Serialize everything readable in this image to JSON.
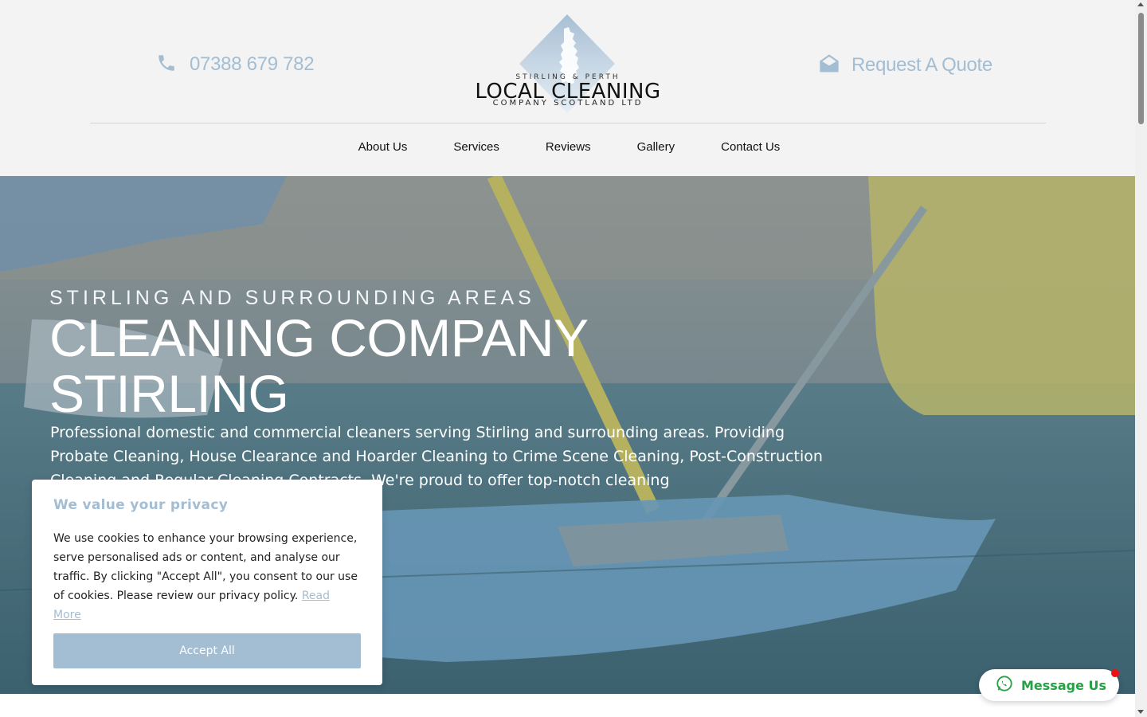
{
  "header": {
    "phone": "07388 679 782",
    "quote": "Request A Quote",
    "logo": {
      "line1": "STIRLING & PERTH",
      "line2": "LOCAL CLEANING",
      "line3": "COMPANY SCOTLAND LTD"
    }
  },
  "nav": {
    "items": [
      "About Us",
      "Services",
      "Reviews",
      "Gallery",
      "Contact Us"
    ]
  },
  "hero": {
    "eyebrow": "STIRLING AND SURROUNDING AREAS",
    "headline": "CLEANING COMPANY STIRLING",
    "description": "Professional domestic and commercial cleaners serving Stirling and surrounding areas. Providing Probate Cleaning, House Clearance and Hoarder Cleaning to Crime Scene Cleaning, Post-Construction Cleaning and Regular Cleaning Contracts. We're proud to offer top-notch cleaning"
  },
  "cookie": {
    "title": "We value your privacy",
    "body": "We use cookies to enhance your browsing experience, serve personalised ads or content, and analyse our traffic. By clicking \"Accept All\", you consent to our use of cookies. Please review our privacy policy.",
    "link": "Read More",
    "accept": "Accept All"
  },
  "message_button": {
    "label": "Message Us"
  },
  "colors": {
    "accent": "#a3bdd2",
    "whatsapp": "#25a244",
    "notification": "#ee1111"
  }
}
